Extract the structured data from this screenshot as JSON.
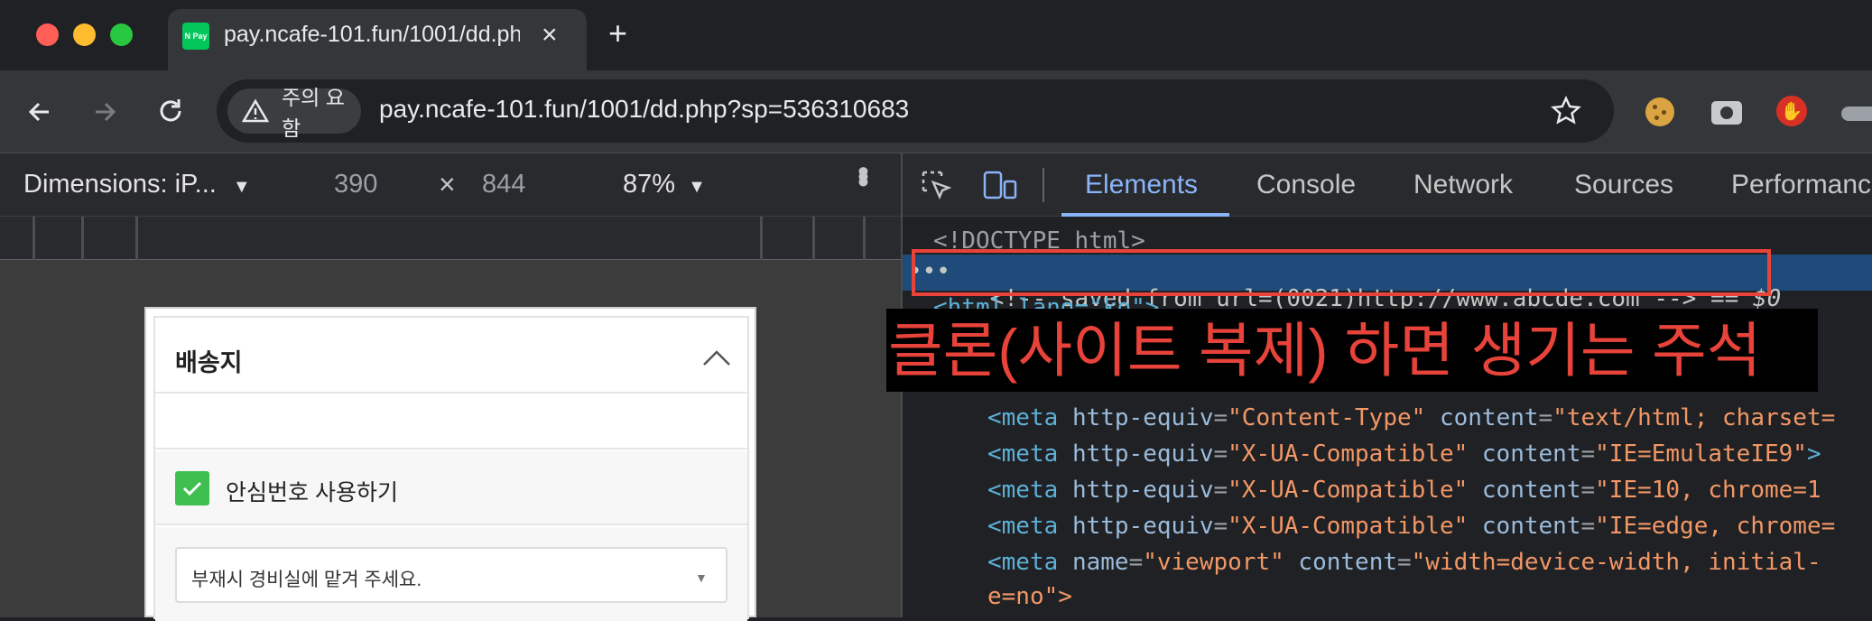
{
  "tab": {
    "title": "pay.ncafe-101.fun/1001/dd.ph",
    "favicon_label": "N Pay",
    "favicon_color": "#03c75a"
  },
  "toolbar": {
    "security_label": "주의 요함",
    "url": "pay.ncafe-101.fun/1001/dd.php?sp=536310683",
    "back_icon": "back-arrow-icon",
    "forward_icon": "forward-arrow-icon",
    "reload_icon": "reload-icon"
  },
  "device_bar": {
    "dimensions_label": "Dimensions: iP...",
    "width": "390",
    "times": "×",
    "height": "844",
    "zoom": "87%"
  },
  "page": {
    "shipping_title": "배송지",
    "safe_number_label": "안심번호 사용하기",
    "safe_number_checked": true,
    "delivery_note": "부재시 경비실에 맡겨 주세요.",
    "accent_color": "#3fbf4f"
  },
  "devtools": {
    "tabs": [
      "Elements",
      "Console",
      "Network",
      "Sources",
      "Performanc"
    ],
    "active_tab": "Elements",
    "lines": {
      "doctype": "<!DOCTYPE html>",
      "comment": "<!-- saved from url=(0021)http://www.abcde.com -->",
      "comment_suffix": "== $0",
      "html_open": "<html lang=\"ko\">",
      "meta1_attr": "http-equiv",
      "meta1_val": "\"Content-Type\"",
      "meta1_c_attr": "content",
      "meta1_c_val": "\"text/html; charset=",
      "meta2_val": "\"X-UA-Compatible\"",
      "meta2_c_val": "\"IE=EmulateIE9\"",
      "meta3_val": "\"X-UA-Compatible\"",
      "meta3_c_val": "\"IE=10, chrome=1",
      "meta4_val": "\"X-UA-Compatible\"",
      "meta4_c_val": "\"IE=edge, chrome=",
      "meta5_attr": "name",
      "meta5_val": "\"viewport\"",
      "meta5_c_val": "\"width=device-width, initial-",
      "meta5_cont": "e=no\">",
      "meta_tag": "<meta",
      "close": ">"
    }
  },
  "annotation": {
    "text": "클론(사이트 복제) 하면 생기는 주석",
    "color": "#e8433a",
    "box_color": "#e8433a"
  }
}
